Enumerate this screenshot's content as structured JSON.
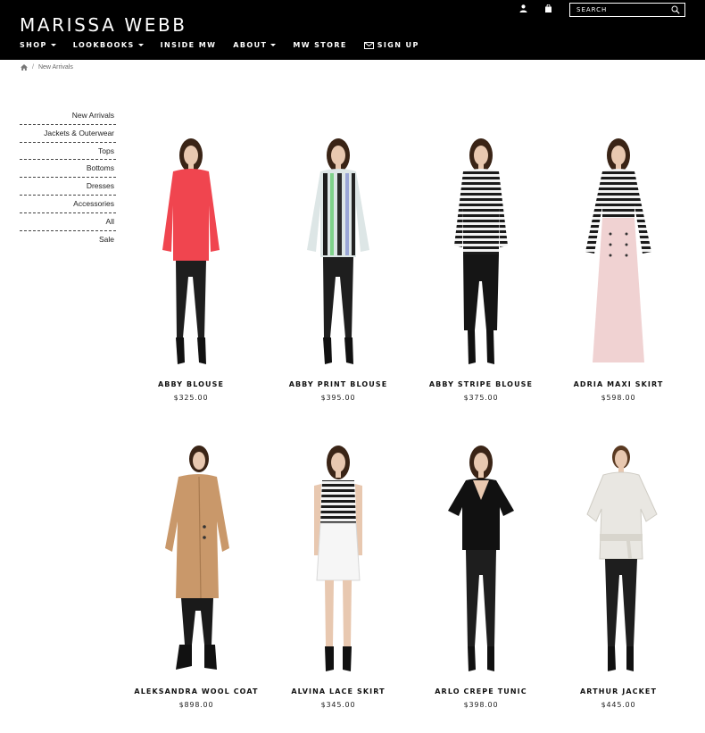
{
  "brand": "MARISSA WEBB",
  "nav": [
    {
      "label": "SHOP",
      "has_caret": true
    },
    {
      "label": "LOOKBOOKS",
      "has_caret": true
    },
    {
      "label": "INSIDE MW",
      "has_caret": false
    },
    {
      "label": "ABOUT",
      "has_caret": true
    },
    {
      "label": "MW STORE",
      "has_caret": false
    },
    {
      "label": "SIGN UP",
      "icon": "mail-icon"
    }
  ],
  "header_icons": [
    "user-icon",
    "shopping-bag-icon"
  ],
  "search": {
    "placeholder": "SEARCH",
    "icon": "search-icon"
  },
  "breadcrumb": {
    "home_icon": "home-icon",
    "separator": "/",
    "current": "New Arrivals"
  },
  "sidebar": {
    "items": [
      "New Arrivals",
      "Jackets & Outerwear",
      "Tops",
      "Bottoms",
      "Dresses",
      "Accessories",
      "All",
      "Sale"
    ]
  },
  "products": [
    {
      "name": "ABBY BLOUSE",
      "price": "$325.00"
    },
    {
      "name": "ABBY PRINT BLOUSE",
      "price": "$395.00"
    },
    {
      "name": "ABBY STRIPE BLOUSE",
      "price": "$375.00"
    },
    {
      "name": "ADRIA MAXI SKIRT",
      "price": "$598.00"
    },
    {
      "name": "ALEKSANDRA WOOL COAT",
      "price": "$898.00"
    },
    {
      "name": "ALVINA LACE SKIRT",
      "price": "$345.00"
    },
    {
      "name": "ARLO CREPE TUNIC",
      "price": "$398.00"
    },
    {
      "name": "ARTHUR JACKET",
      "price": "$445.00"
    }
  ],
  "colors": {
    "header_bg": "#000000",
    "header_text": "#ffffff",
    "page_bg": "#ffffff"
  }
}
